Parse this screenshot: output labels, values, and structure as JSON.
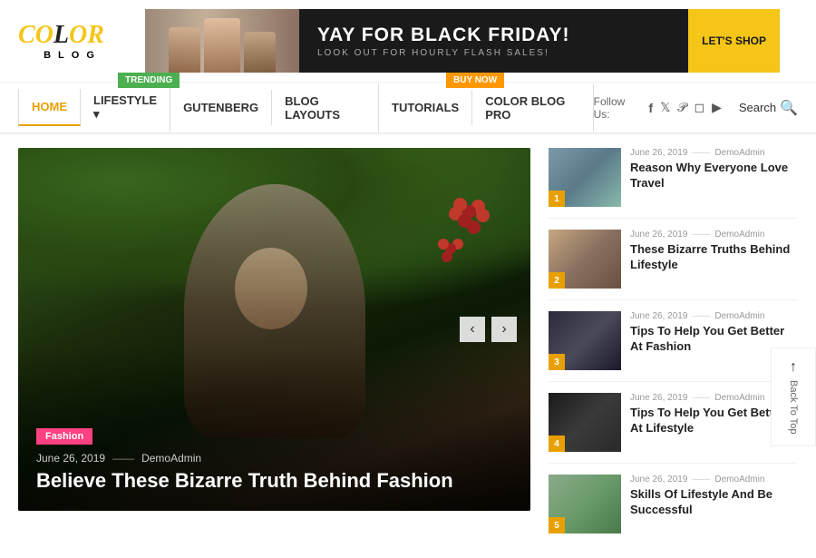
{
  "header": {
    "logo_color": "COLOR",
    "logo_blog": "BLOG",
    "ad": {
      "headline": "YAY FOR BLACK FRIDAY!",
      "subline": "LOOK OUT FOR HOURLY FLASH SALES!",
      "cta": "LET'S SHOP"
    }
  },
  "nav": {
    "trending_badge": "TRENDING",
    "buy_now_badge": "BUY NOW",
    "items": [
      {
        "label": "HOME",
        "active": true
      },
      {
        "label": "LIFESTYLE ▾",
        "active": false
      },
      {
        "label": "GUTENBERG",
        "active": false
      },
      {
        "label": "BLOG LAYOUTS",
        "active": false
      },
      {
        "label": "TUTORIALS",
        "active": false
      },
      {
        "label": "COLOR BLOG PRO",
        "active": false
      }
    ],
    "follow_label": "Follow Us:",
    "social_icons": [
      "f",
      "t",
      "p",
      "i",
      "▶"
    ],
    "search_label": "Search"
  },
  "hero": {
    "category": "Fashion",
    "date": "June 26, 2019",
    "author": "DemoAdmin",
    "title": "Believe These Bizarre Truth Behind Fashion",
    "prev_label": "‹",
    "next_label": "›"
  },
  "sidebar": {
    "items": [
      {
        "num": "1",
        "date": "June 26, 2019",
        "author": "DemoAdmin",
        "title": "Reason Why Everyone Love Travel"
      },
      {
        "num": "2",
        "date": "June 26, 2019",
        "author": "DemoAdmin",
        "title": "These Bizarre Truths Behind Lifestyle"
      },
      {
        "num": "3",
        "date": "June 26, 2019",
        "author": "DemoAdmin",
        "title": "Tips To Help You Get Better At Fashion"
      },
      {
        "num": "4",
        "date": "June 26, 2019",
        "author": "DemoAdmin",
        "title": "Tips To Help You Get Better At Lifestyle"
      },
      {
        "num": "5",
        "date": "June 26, 2019",
        "author": "DemoAdmin",
        "title": "Skills Of Lifestyle And Be Successful"
      }
    ]
  },
  "back_to_top": "Back To Top"
}
